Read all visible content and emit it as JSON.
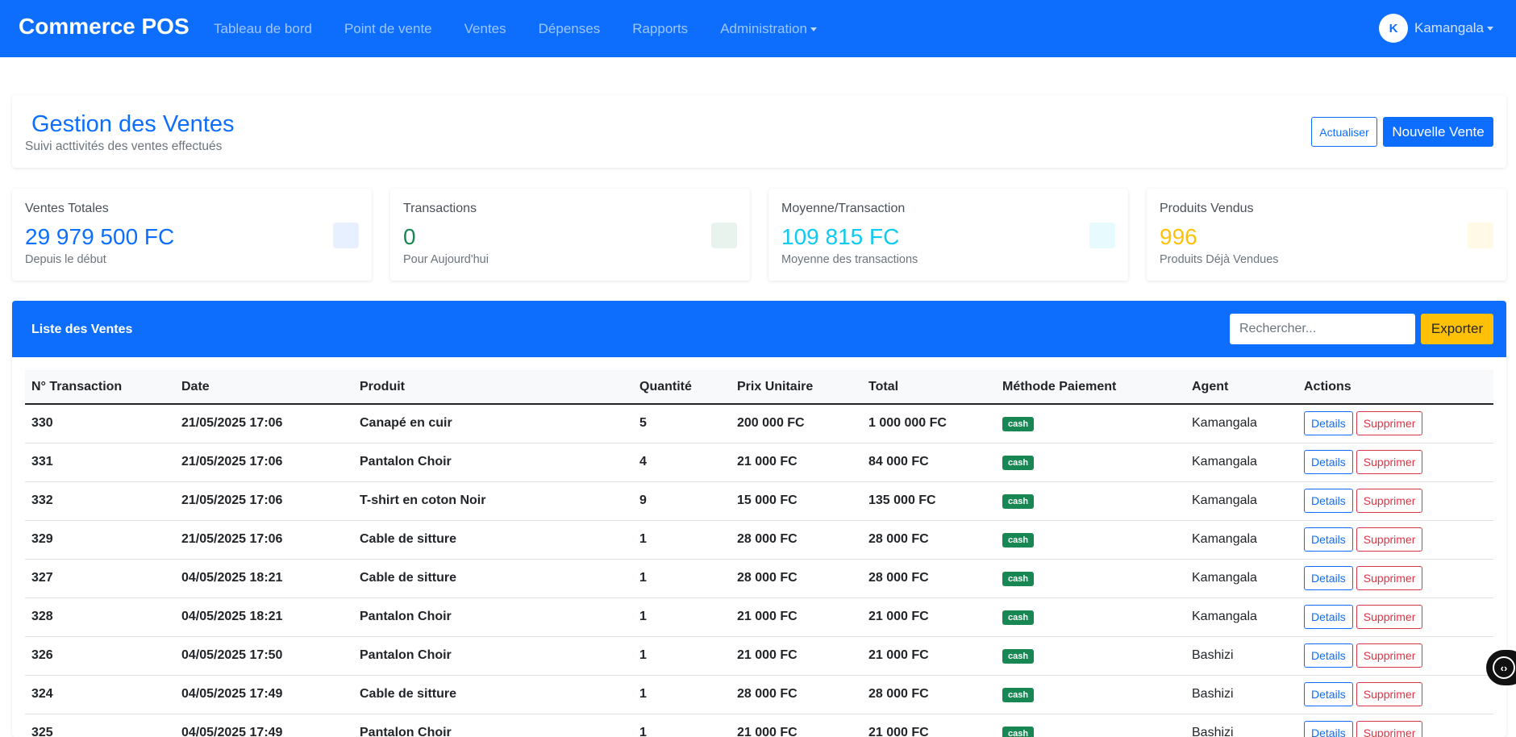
{
  "navbar": {
    "brand": "Commerce POS",
    "links": [
      "Tableau de bord",
      "Point de vente",
      "Ventes",
      "Dépenses",
      "Rapports",
      "Administration"
    ],
    "user_initial": "K",
    "user_name": "Kamangala"
  },
  "header": {
    "title": "Gestion des Ventes",
    "subtitle": "Suivi acttivités des ventes effectués",
    "refresh_label": "Actualiser",
    "new_sale_label": "Nouvelle Vente"
  },
  "stats": [
    {
      "label": "Ventes Totales",
      "value": "29 979 500 FC",
      "note": "Depuis le début",
      "color": "#0d6efd",
      "icon_bg": "#e7f0fe"
    },
    {
      "label": "Transactions",
      "value": "0",
      "note": "Pour Aujourd'hui",
      "color": "#198754",
      "icon_bg": "#e8f3ee"
    },
    {
      "label": "Moyenne/Transaction",
      "value": "109 815 FC",
      "note": "Moyenne des transactions",
      "color": "#0dcaf0",
      "icon_bg": "#e7fafd"
    },
    {
      "label": "Produits Vendus",
      "value": "996",
      "note": "Produits Déjà Vendues",
      "color": "#ffc107",
      "icon_bg": "#fff9e6"
    }
  ],
  "list": {
    "title": "Liste des Ventes",
    "search_placeholder": "Rechercher...",
    "export_label": "Exporter",
    "columns": [
      "N° Transaction",
      "Date",
      "Produit",
      "Quantité",
      "Prix Unitaire",
      "Total",
      "Méthode Paiement",
      "Agent",
      "Actions"
    ],
    "details_label": "Details",
    "delete_label": "Supprimer",
    "rows": [
      {
        "id": "330",
        "date": "21/05/2025 17:06",
        "product": "Canapé en cuir",
        "qty": "5",
        "unit": "200 000 FC",
        "total": "1 000 000 FC",
        "method": "cash",
        "agent": "Kamangala"
      },
      {
        "id": "331",
        "date": "21/05/2025 17:06",
        "product": "Pantalon Choir",
        "qty": "4",
        "unit": "21 000 FC",
        "total": "84 000 FC",
        "method": "cash",
        "agent": "Kamangala"
      },
      {
        "id": "332",
        "date": "21/05/2025 17:06",
        "product": "T-shirt en coton Noir",
        "qty": "9",
        "unit": "15 000 FC",
        "total": "135 000 FC",
        "method": "cash",
        "agent": "Kamangala"
      },
      {
        "id": "329",
        "date": "21/05/2025 17:06",
        "product": "Cable de sitture",
        "qty": "1",
        "unit": "28 000 FC",
        "total": "28 000 FC",
        "method": "cash",
        "agent": "Kamangala"
      },
      {
        "id": "327",
        "date": "04/05/2025 18:21",
        "product": "Cable de sitture",
        "qty": "1",
        "unit": "28 000 FC",
        "total": "28 000 FC",
        "method": "cash",
        "agent": "Kamangala"
      },
      {
        "id": "328",
        "date": "04/05/2025 18:21",
        "product": "Pantalon Choir",
        "qty": "1",
        "unit": "21 000 FC",
        "total": "21 000 FC",
        "method": "cash",
        "agent": "Kamangala"
      },
      {
        "id": "326",
        "date": "04/05/2025 17:50",
        "product": "Pantalon Choir",
        "qty": "1",
        "unit": "21 000 FC",
        "total": "21 000 FC",
        "method": "cash",
        "agent": "Bashizi"
      },
      {
        "id": "324",
        "date": "04/05/2025 17:49",
        "product": "Cable de sitture",
        "qty": "1",
        "unit": "28 000 FC",
        "total": "28 000 FC",
        "method": "cash",
        "agent": "Bashizi"
      },
      {
        "id": "325",
        "date": "04/05/2025 17:49",
        "product": "Pantalon Choir",
        "qty": "1",
        "unit": "21 000 FC",
        "total": "21 000 FC",
        "method": "cash",
        "agent": "Bashizi"
      }
    ]
  },
  "colors": {
    "primary": "#0d6efd",
    "success": "#198754",
    "warning": "#ffc107",
    "danger": "#dc3545"
  }
}
